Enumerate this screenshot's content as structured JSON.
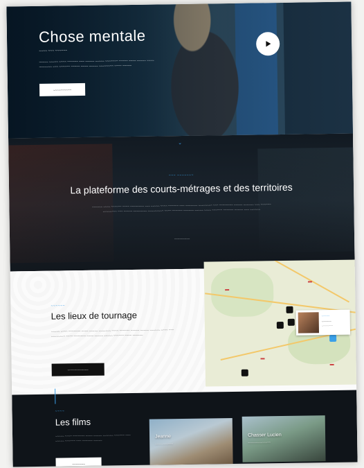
{
  "hero": {
    "title": "Chose mentale",
    "subtitle": "~~~~ ~~~ ~~~~~~",
    "description": "~~~~~ ~~~~~ ~~~~ ~~~~~~ ~~~ ~~~~~ ~~~~~ ~~~~~~~ ~~~~~ ~~~~ ~~~~~ ~~~~ ~~~~~~~ ~~~ ~~~~~~ ~~~~~ ~~~~ ~~~~~ ~~~~~~~~ ~~~~ ~~~~~",
    "cta_label": "~~~~~~~~~~"
  },
  "platform": {
    "kicker": "~~~ ~~~~~~~",
    "title": "La plateforme des courts-métrages et des territoires",
    "text": "~~~~~~ ~~~~ ~~~~~~ ~~~~ ~~~~~~~~ ~~~ ~~~~~ ~~~~ ~~~~~~ ~~~ ~~~~~~~ ~~~~~~~~ ~~~ ~~~~~~~~ ~~~~~ ~~~~~~ ~~~ ~~~~~~ ~~~~~~~~ ~~~ ~~~~~ ~~~~~~~~ ~~~~~~~~~ ~~~~ ~~~~~~ ~~~~~~ ~~~~~ ~~~~ ~~~~~~ ~~~~~~ ~~~~~ ~~~ ~~~~~~",
    "link_label": "~~~~~~~~~"
  },
  "lieux": {
    "kicker": "~~~~~~",
    "title": "Les lieux de tournage",
    "text": "~~~~~ ~~~~ ~~~~~~~ ~~~~ ~~~~~ ~~~~~~~ ~~~~ ~~~~~~ ~~~~~ ~~~~~ ~~~~~~ ~~~~ ~~~ ~~~~~~~~ ~~~~ ~~~~~~~ ~~~~ ~~~~~ ~~~~~ ~~~~~~ ~~~~ ~~~~~~",
    "cta_label": "~~~~~~~~~~~~",
    "map_card": {
      "kicker": "~~~~~",
      "title": "~~~~~~",
      "meta": "~~~~~~~~"
    }
  },
  "films": {
    "kicker": "~~~~",
    "title": "Les films",
    "text": "~~~~~ ~~~~ ~~~~~~~ ~~~~ ~~~~~ ~~~~~~ ~~~~~~ ~~~ ~~~~~ ~~~~~~ ~~~ ~~~~~~ ~~~~~",
    "cta_label": "~~~~~~~",
    "cards": [
      {
        "title": "Jeanne",
        "meta": "~~~~~~~~~~~"
      },
      {
        "title": "Chasser Lucien",
        "meta": "~~~~~~~~~~~~~~"
      }
    ]
  },
  "colors": {
    "accent": "#3aa0e8",
    "dark": "#0f1419"
  }
}
